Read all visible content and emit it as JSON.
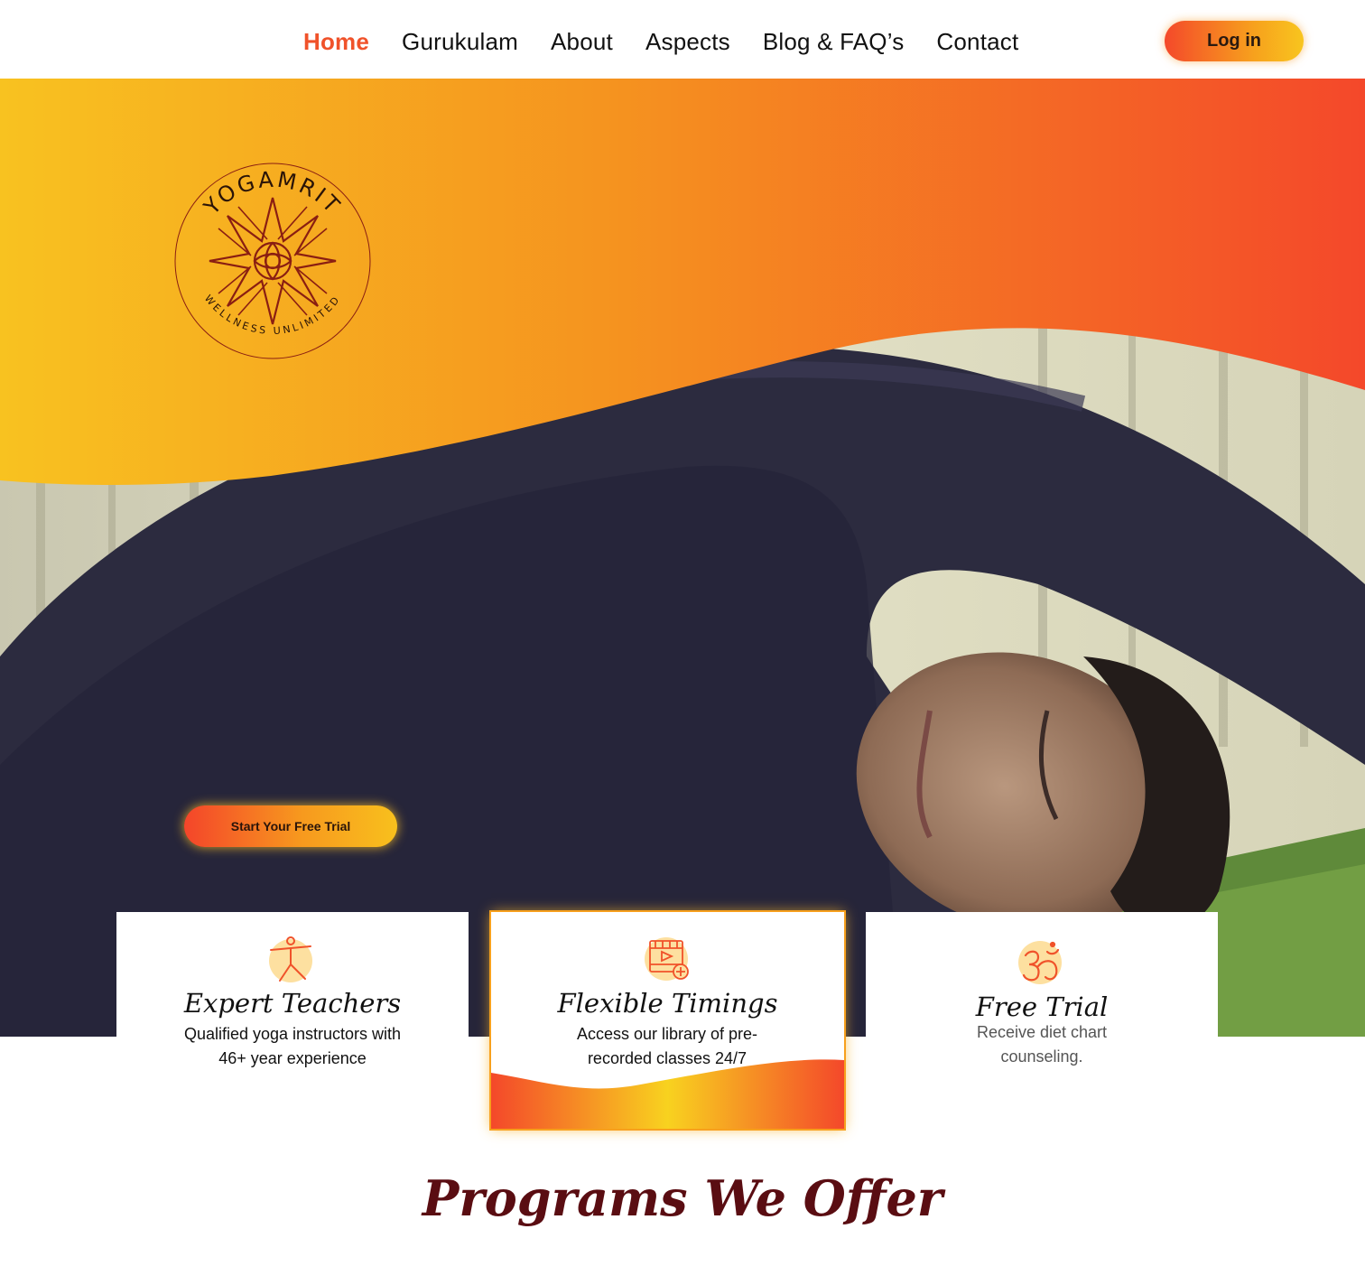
{
  "nav": {
    "links": [
      {
        "label": "Home",
        "active": true
      },
      {
        "label": "Gurukulam",
        "active": false
      },
      {
        "label": "About",
        "active": false
      },
      {
        "label": "Aspects",
        "active": false
      },
      {
        "label": "Blog & FAQ’s",
        "active": false
      },
      {
        "label": "Contact",
        "active": false
      }
    ],
    "login_label": "Log in"
  },
  "hero": {
    "logo": {
      "top_text": "YOGAMRIT",
      "bottom_text": "WELLNESS UNLIMITED",
      "icon": "mandala-sun-icon"
    },
    "cta_label": "Start Your Free Trial",
    "image": "woman-side-stretch-yoga-photo"
  },
  "features": [
    {
      "icon": "yoga-pose-icon",
      "title": "Expert Teachers",
      "desc_line1": "Qualified yoga instructors with",
      "desc_line2": "46+ year experience"
    },
    {
      "icon": "video-library-icon",
      "title": "Flexible Timings",
      "desc_line1": "Access our library of pre-",
      "desc_line2": "recorded classes 24/7"
    },
    {
      "icon": "om-icon",
      "title": "Free Trial",
      "desc_line1": "Receive diet chart",
      "desc_line2": "counseling."
    }
  ],
  "programs": {
    "title": "Programs We Offer"
  },
  "colors": {
    "accent": "#f0522a",
    "gradient_start": "#f8c41f",
    "gradient_end": "#f4482a",
    "heading": "#5a0d12",
    "logo_ink": "#8a1e12"
  }
}
